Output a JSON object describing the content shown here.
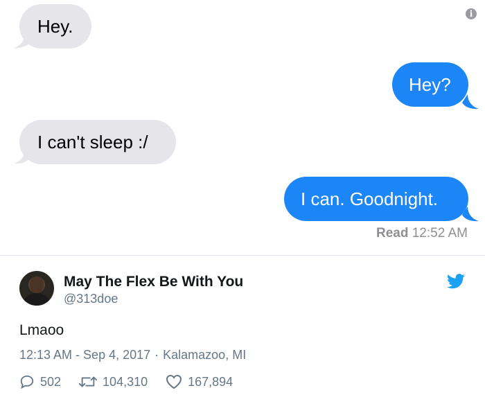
{
  "messages": {
    "m1": {
      "text": "Hey.",
      "direction": "incoming"
    },
    "m2": {
      "text": "Hey?",
      "direction": "outgoing"
    },
    "m3": {
      "text": "I can't sleep :/",
      "direction": "incoming"
    },
    "m4": {
      "text": "I can. Goodnight.",
      "direction": "outgoing"
    }
  },
  "receipt": {
    "label": "Read",
    "time": "12:52 AM"
  },
  "info_icon": {
    "glyph": "i",
    "name": "info-icon"
  },
  "tweet": {
    "author_name": "May The Flex Be With You",
    "handle": "@313doe",
    "text": "Lmaoo",
    "time": "12:13 AM - Sep 4, 2017",
    "separator": "·",
    "location": "Kalamazoo, MI",
    "replies": "502",
    "retweets": "104,310",
    "likes": "167,894"
  },
  "colors": {
    "incoming_bubble": "#e5e5ea",
    "outgoing_bubble": "#1c86f7",
    "twitter_blue": "#1da1f2",
    "secondary_text": "#657786"
  }
}
